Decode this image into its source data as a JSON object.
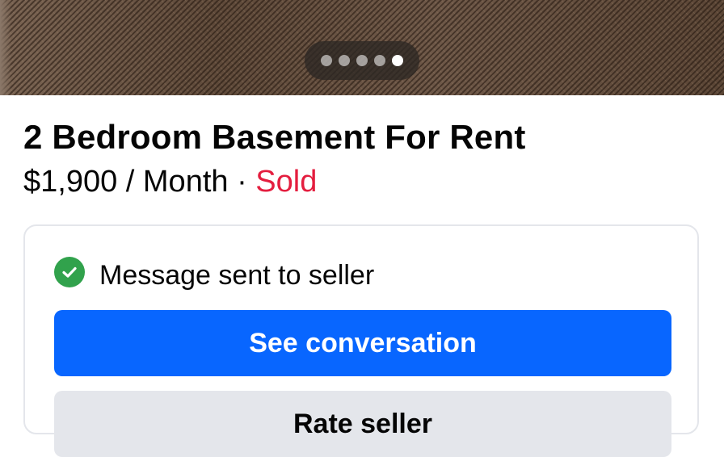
{
  "photo": {
    "carousel_dot_count": 5,
    "active_dot_index": 4
  },
  "listing": {
    "title": "2 Bedroom Basement For Rent",
    "price": "$1,900 / Month",
    "separator": " · ",
    "status": "Sold"
  },
  "seller_card": {
    "status_icon": "check-circle-icon",
    "status_text": "Message sent to seller",
    "primary_button": "See conversation",
    "secondary_button": "Rate seller"
  },
  "colors": {
    "primary": "#0866ff",
    "sold": "#e41e3f",
    "success": "#31a24c",
    "secondary_button_bg": "#e4e6eb"
  }
}
